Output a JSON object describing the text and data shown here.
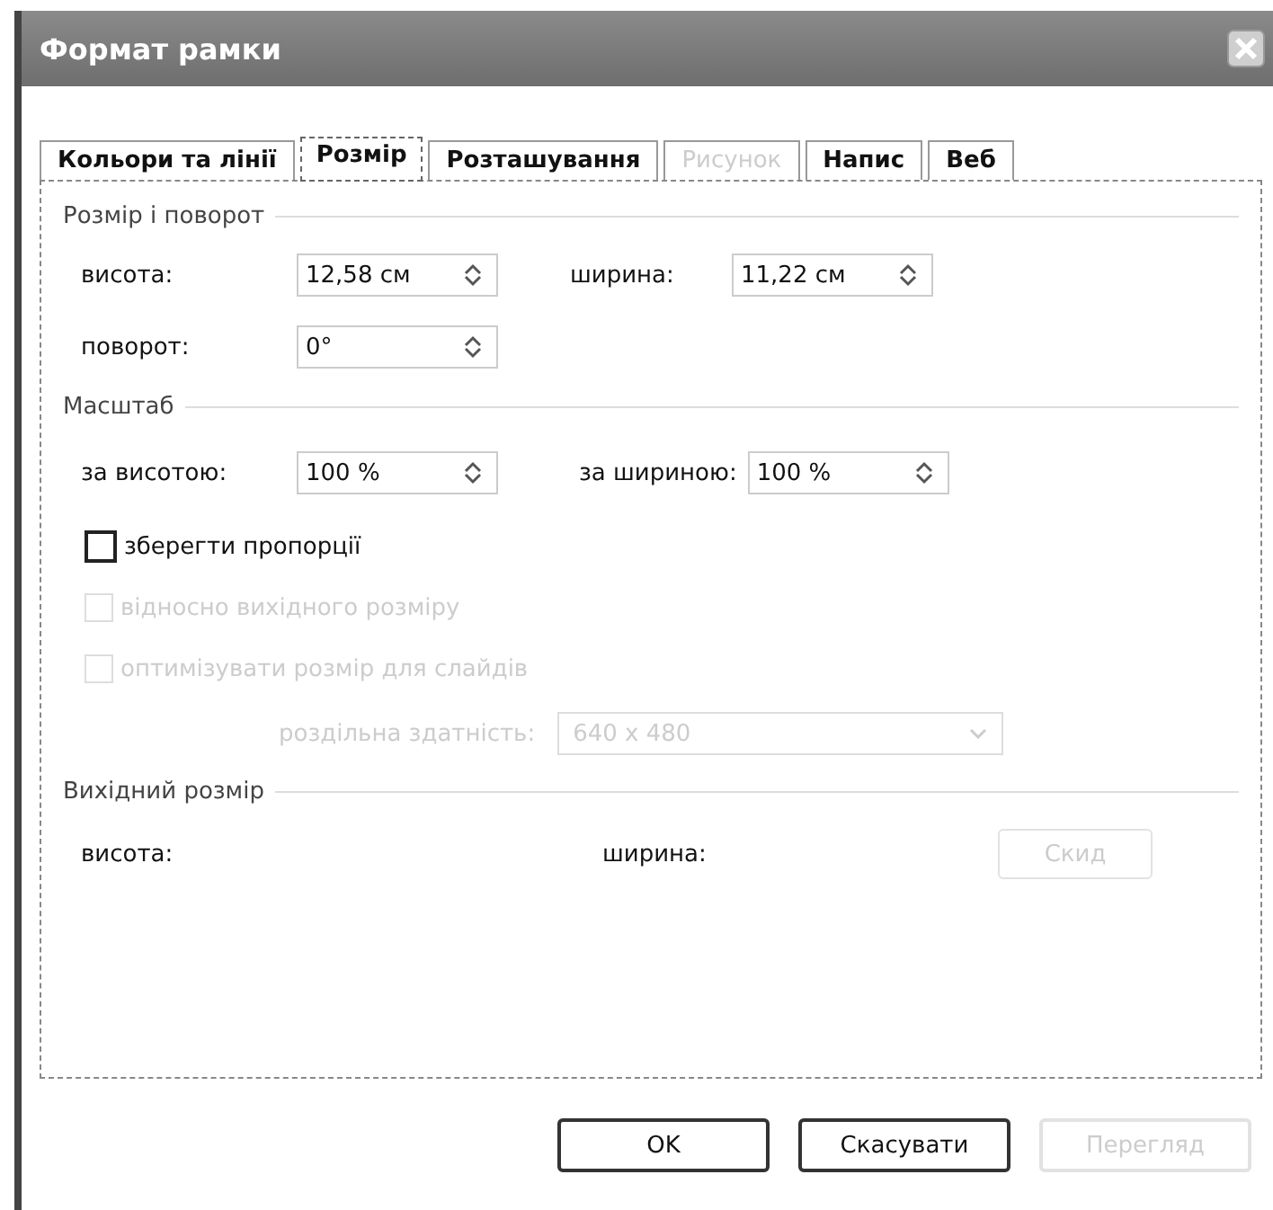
{
  "window": {
    "title": "Формат рамки"
  },
  "tabs": [
    {
      "label": "Кольори та лінії",
      "selected": false,
      "disabled": false
    },
    {
      "label": "Розмір",
      "selected": true,
      "disabled": false
    },
    {
      "label": "Розташування",
      "selected": false,
      "disabled": false
    },
    {
      "label": "Рисунок",
      "selected": false,
      "disabled": true
    },
    {
      "label": "Напис",
      "selected": false,
      "disabled": false
    },
    {
      "label": "Веб",
      "selected": false,
      "disabled": false
    }
  ],
  "size_rotation": {
    "heading": "Розмір і поворот",
    "height": {
      "label": "висота:",
      "value": "12,58 см"
    },
    "width": {
      "label": "ширина:",
      "value": "11,22 см"
    },
    "rotation": {
      "label": "поворот:",
      "value": "0°"
    }
  },
  "scale": {
    "heading": "Масштаб",
    "height": {
      "label": "за висотою:",
      "value": "100 %"
    },
    "width": {
      "label": "за шириною:",
      "value": "100 %"
    },
    "options": [
      {
        "kind": "checkbox",
        "label": "зберегти пропорції",
        "checked": false,
        "disabled": false
      },
      {
        "kind": "checkbox",
        "label": "відносно вихідного розміру",
        "checked": false,
        "disabled": true
      },
      {
        "kind": "checkbox",
        "label": "оптимізувати розмір для слайдів",
        "checked": false,
        "disabled": true
      }
    ],
    "resolution": {
      "label": "роздільна здатність:",
      "value": "640 x 480",
      "disabled": true
    }
  },
  "original_size": {
    "heading": "Вихідний розмір",
    "height_label": "висота:",
    "width_label": "ширина:",
    "reset": {
      "label": "Скид",
      "disabled": true
    }
  },
  "buttons": [
    {
      "label": "OK",
      "disabled": false
    },
    {
      "label": "Скасувати",
      "disabled": false
    },
    {
      "label": "Перегляд",
      "disabled": true
    }
  ]
}
